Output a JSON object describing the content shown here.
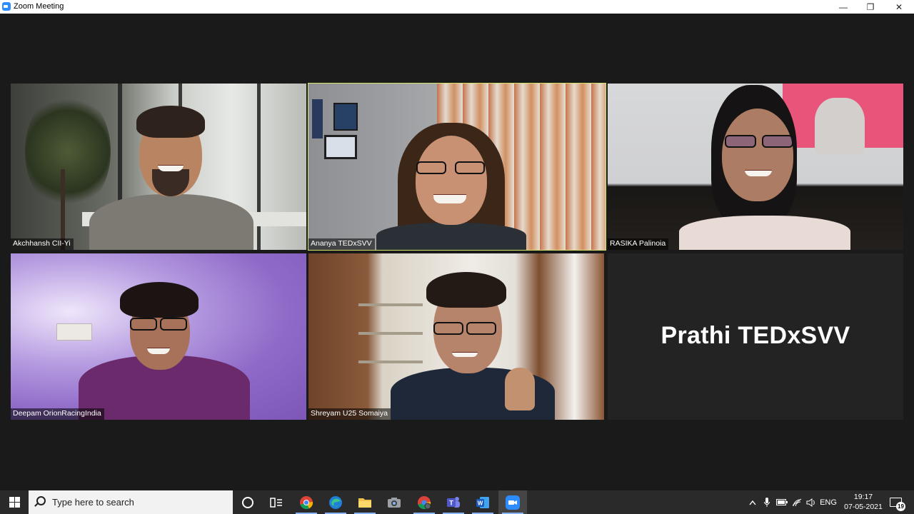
{
  "window": {
    "title": "Zoom Meeting",
    "controls": {
      "minimize": "—",
      "maximize": "❐",
      "close": "✕"
    }
  },
  "participants": [
    {
      "name": "Akchhansh CII-Yi",
      "video": true,
      "active_speaker": false
    },
    {
      "name": "Ananya TEDxSVV",
      "video": true,
      "active_speaker": true
    },
    {
      "name": "RASIKA Palinoia",
      "video": true,
      "active_speaker": false
    },
    {
      "name": "Deepam OrionRacingIndia",
      "video": true,
      "active_speaker": false
    },
    {
      "name": "Shreyam U25 Somaiya",
      "video": true,
      "active_speaker": false
    },
    {
      "name": "Prathi TEDxSVV",
      "video": false,
      "active_speaker": false
    }
  ],
  "taskbar": {
    "search_placeholder": "Type here to search",
    "pinned_apps": [
      "task-view",
      "chrome",
      "edge",
      "file-explorer",
      "camera",
      "chrome-profile",
      "teams",
      "word",
      "zoom"
    ],
    "tray": {
      "language": "ENG",
      "time": "19:17",
      "date": "07-05-2021",
      "notification_count": "19"
    }
  },
  "colors": {
    "active_speaker_border": "#d6e36b",
    "meeting_background": "#1a1a1a",
    "taskbar": "#2a2a2a",
    "zoom_blue": "#2d8cff"
  }
}
